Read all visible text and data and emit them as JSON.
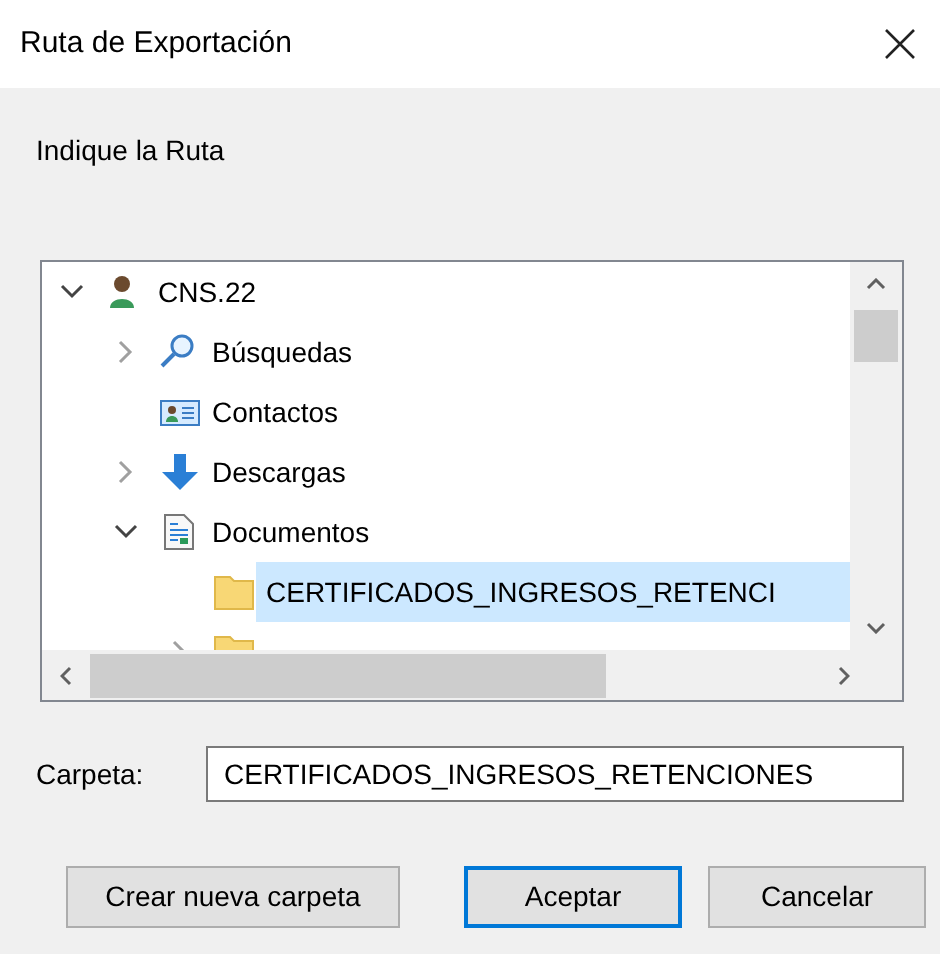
{
  "window": {
    "title": "Ruta de Exportación"
  },
  "prompt": "Indique la Ruta",
  "tree": [
    {
      "label": "CNS.22",
      "kind": "user",
      "expanded": true,
      "children": [
        {
          "label": "Búsquedas",
          "kind": "search",
          "expanded": false
        },
        {
          "label": "Contactos",
          "kind": "contacts"
        },
        {
          "label": "Descargas",
          "kind": "download",
          "expanded": false
        },
        {
          "label": "Documentos",
          "kind": "document",
          "expanded": true,
          "children": [
            {
              "label": "CERTIFICADOS_INGRESOS_RETENCI",
              "kind": "folder",
              "selected": true
            },
            {
              "kind": "folder",
              "expanded": false
            }
          ]
        }
      ]
    }
  ],
  "folder_field": {
    "label": "Carpeta:",
    "value": "CERTIFICADOS_INGRESOS_RETENCIONES"
  },
  "buttons": [
    {
      "label": "Crear nueva carpeta",
      "default": false
    },
    {
      "label": "Aceptar",
      "default": true
    },
    {
      "label": "Cancelar",
      "default": false
    }
  ]
}
